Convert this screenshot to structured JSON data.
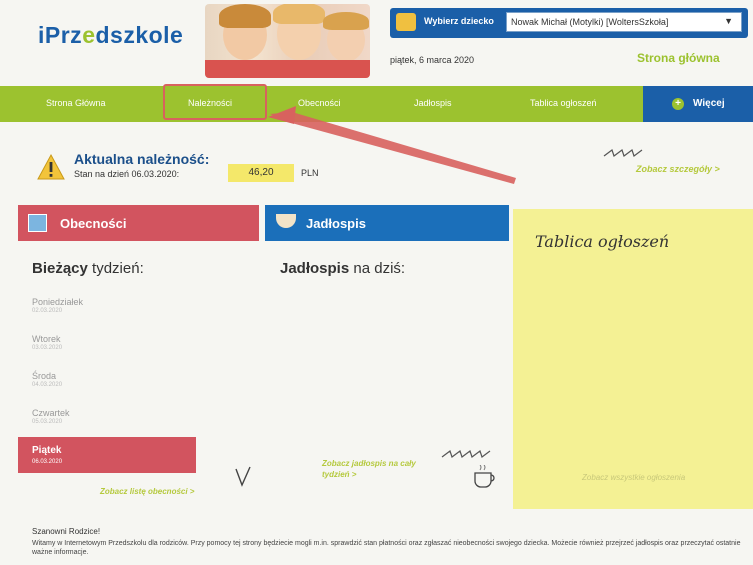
{
  "header": {
    "logo_prefix": "iPrz",
    "logo_highlight": "e",
    "logo_suffix": "dszkole",
    "child_label": "Wybierz dziecko",
    "child_selected": "Nowak Michał (Motylki) [WoltersSzkoła]",
    "date": "piątek, 6 marca 2020",
    "home_link": "Strona główna"
  },
  "nav": {
    "items": [
      "Strona Główna",
      "Należności",
      "Obecności",
      "Jadłospis",
      "Tablica ogłoszeń"
    ],
    "more": "Więcej"
  },
  "balance": {
    "title": "Aktualna należność:",
    "date_label": "Stan na dzień 06.03.2020:",
    "amount": "46,20",
    "currency": "PLN",
    "details_link": "Zobacz szczegóły >"
  },
  "attendance": {
    "tab": "Obecności",
    "week_strong": "Bieżący",
    "week_rest": " tydzień:",
    "days": [
      {
        "name": "Poniedziałek",
        "date": "02.03.2020"
      },
      {
        "name": "Wtorek",
        "date": "03.03.2020"
      },
      {
        "name": "Środa",
        "date": "04.03.2020"
      },
      {
        "name": "Czwartek",
        "date": "05.03.2020"
      }
    ],
    "active_day": {
      "name": "Piątek",
      "date": "06.03.2020"
    },
    "link": "Zobacz listę obecności >"
  },
  "menu": {
    "tab": "Jadłospis",
    "head_strong": "Jadłospis",
    "head_rest": " na dziś:",
    "link": "Zobacz jadłospis na cały tydzień >"
  },
  "board": {
    "title": "Tablica ogłoszeń",
    "link": "Zobacz wszystkie ogłoszenia"
  },
  "footer": {
    "title": "Szanowni Rodzice!",
    "text": "Witamy w Internetowym Przedszkolu dla rodziców. Przy pomocy tej strony będziecie mogli m.in. sprawdzić stan płatności oraz zgłaszać nieobecności swojego dziecka. Możecie również przejrzeć jadłospis oraz przeczytać ostatnie ważne informacje."
  },
  "colors": {
    "brand_blue": "#1b5fa8",
    "nav_green": "#9cc22f",
    "attendance_red": "#d2545f",
    "board_yellow": "#f4f194"
  }
}
